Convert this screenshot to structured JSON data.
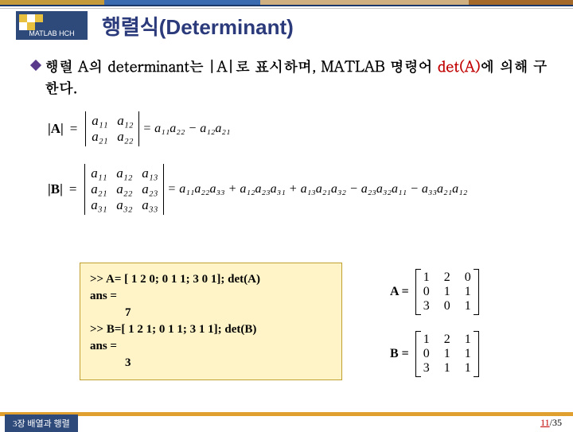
{
  "header": {
    "logo_label": "MATLAB HCH",
    "title": "행렬식(Determinant)"
  },
  "bullet": {
    "text_prefix": "행렬 A의 determinant는 |A|로 표시하며, MATLAB 명령어 ",
    "highlight": "det(A)",
    "text_suffix": "에 의해 구한다."
  },
  "math2": {
    "label": "|A|",
    "a11": "a₁₁",
    "a12": "a₁₂",
    "a21": "a₂₁",
    "a22": "a₂₂",
    "rhs": "= a₁₁a₂₂ − a₁₂a₂₁"
  },
  "math3": {
    "label": "|B|",
    "a11": "a₁₁",
    "a12": "a₁₂",
    "a13": "a₁₃",
    "a21": "a₂₁",
    "a22": "a₂₂",
    "a23": "a₂₃",
    "a31": "a₃₁",
    "a32": "a₃₂",
    "a33": "a₃₃",
    "rhs": "= a₁₁a₂₂a₃₃ + a₁₂a₂₃a₃₁ + a₁₃a₂₁a₃₂ − a₂₃a₃₂a₁₁ − a₃₃a₂₁a₁₂"
  },
  "code": {
    "l1": ">> A= [ 1  2  0;  0  1  1; 3  0  1];  det(A)",
    "l2": "ans =",
    "l3": "7",
    "l4": ">> B=[ 1  2  1;  0  1  1; 3  1  1];  det(B)",
    "l5": "ans =",
    "l6": "3"
  },
  "matA": {
    "label": "A =",
    "r1": [
      "1",
      "2",
      "0"
    ],
    "r2": [
      "0",
      "1",
      "1"
    ],
    "r3": [
      "3",
      "0",
      "1"
    ]
  },
  "matB": {
    "label": "B =",
    "r1": [
      "1",
      "2",
      "1"
    ],
    "r2": [
      "0",
      "1",
      "1"
    ],
    "r3": [
      "3",
      "1",
      "1"
    ]
  },
  "footer": {
    "chapter": "3장 배열과 행렬",
    "page_cur": "11",
    "page_total": "/35"
  }
}
